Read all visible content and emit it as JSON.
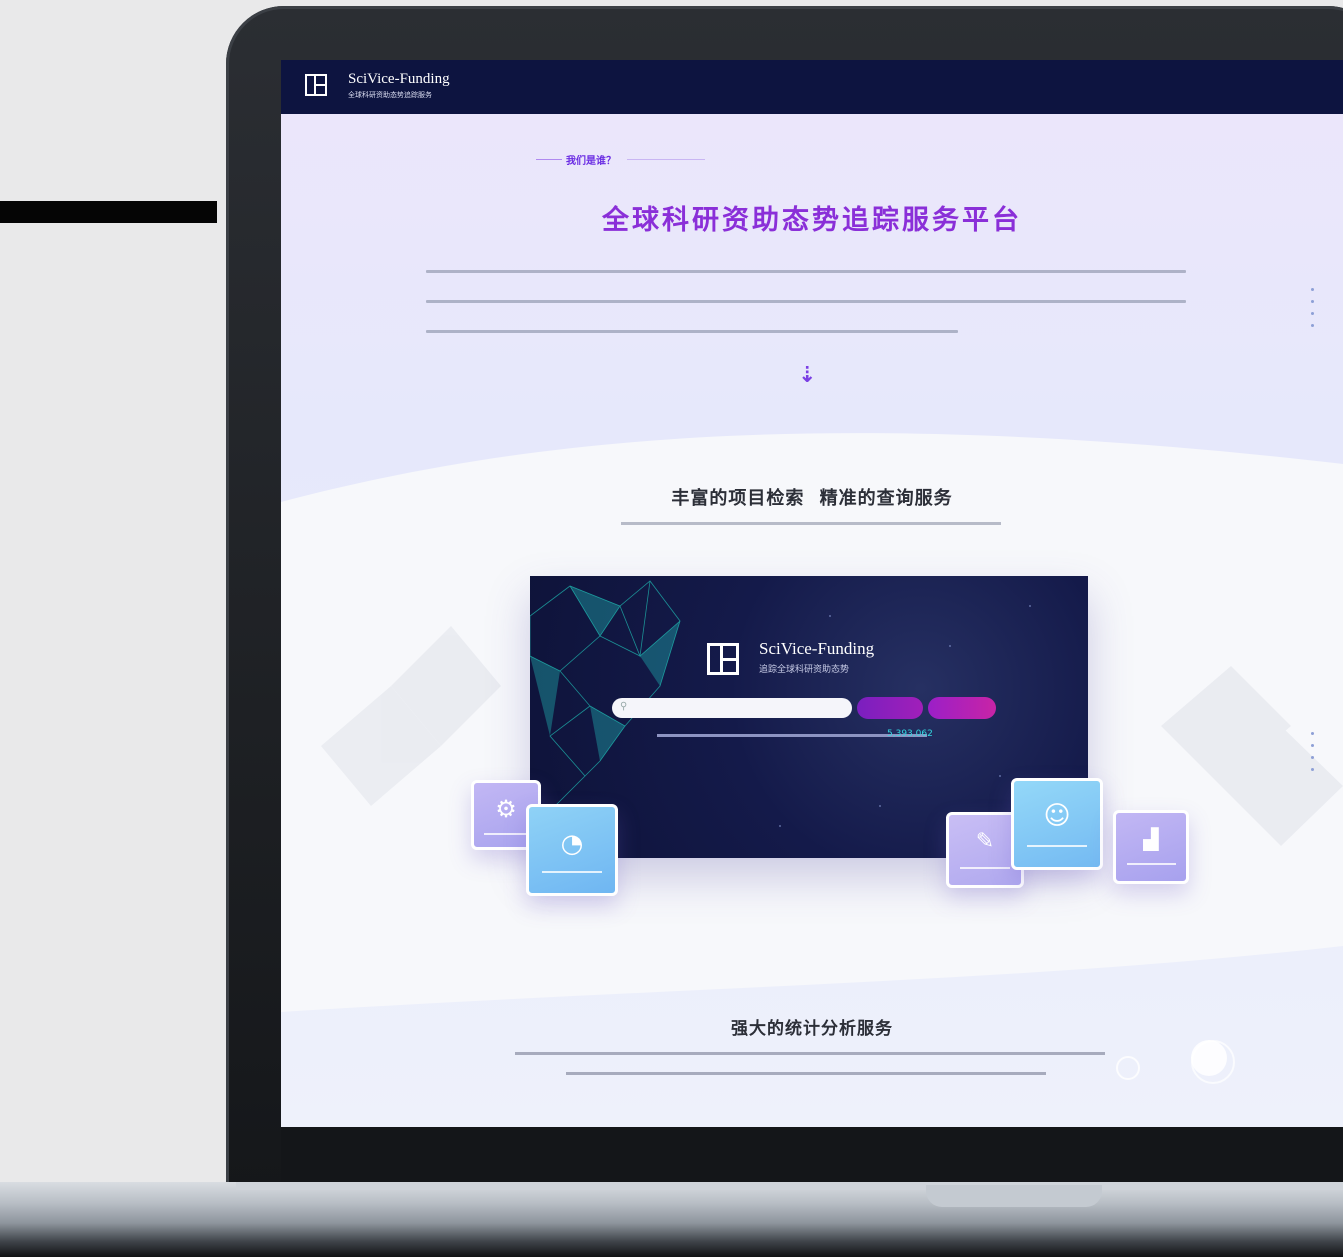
{
  "header": {
    "brand": "SciVice-Funding",
    "brand_sub": "全球科研资助态势追踪服务"
  },
  "hero": {
    "tag": "我们是谁？",
    "title": "全球科研资助态势追踪服务平台"
  },
  "section1": {
    "title": "丰富的项目检索  精准的查询服务"
  },
  "app": {
    "brand": "SciVice-Funding",
    "brand_sub": "追踪全球科研资助态势",
    "stats_count": "5,393,062"
  },
  "section2": {
    "title": "强大的统计分析服务"
  },
  "icons": {
    "arrow": "arrow-down-icon",
    "tiles": [
      "gear-icon",
      "pie-icon",
      "paperclip-icon",
      "brain-icon",
      "bar-chart-icon"
    ]
  },
  "colors": {
    "header_bg": "#0d1440",
    "title_purple": "#8a2fd8",
    "accent_cyan": "#32d8e0"
  }
}
